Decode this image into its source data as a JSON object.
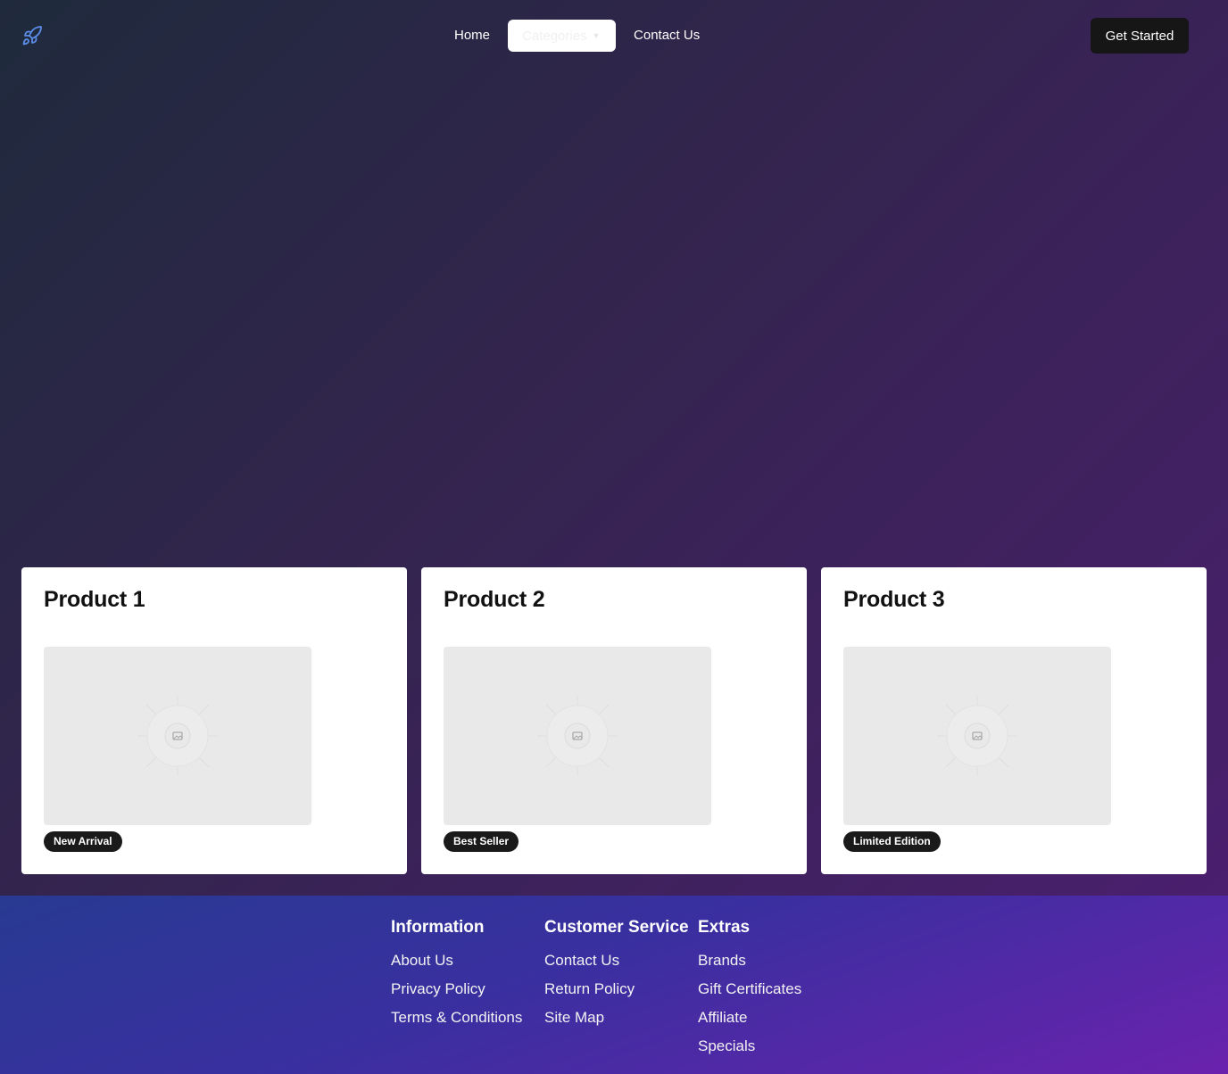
{
  "header": {
    "logo_icon": "rocket-icon",
    "nav": {
      "home": "Home",
      "categories": "Categories",
      "contact": "Contact Us"
    },
    "cta_label": "Get Started"
  },
  "products": [
    {
      "title": "Product 1",
      "badge": "New Arrival",
      "image_icon": "image-placeholder-icon"
    },
    {
      "title": "Product 2",
      "badge": "Best Seller",
      "image_icon": "image-placeholder-icon"
    },
    {
      "title": "Product 3",
      "badge": "Limited Edition",
      "image_icon": "image-placeholder-icon"
    }
  ],
  "footer": {
    "columns": [
      {
        "heading": "Information",
        "links": [
          "About Us",
          "Privacy Policy",
          "Terms & Conditions"
        ]
      },
      {
        "heading": "Customer Service",
        "links": [
          "Contact Us",
          "Return Policy",
          "Site Map"
        ]
      },
      {
        "heading": "Extras",
        "links": [
          "Brands",
          "Gift Certificates",
          "Affiliate",
          "Specials"
        ]
      }
    ]
  },
  "colors": {
    "accent_logo": "#5b8de8",
    "button_dark": "#161616",
    "badge_dark": "#1a1a1a",
    "card_bg": "#ffffff",
    "image_placeholder": "#e9e9e9"
  }
}
